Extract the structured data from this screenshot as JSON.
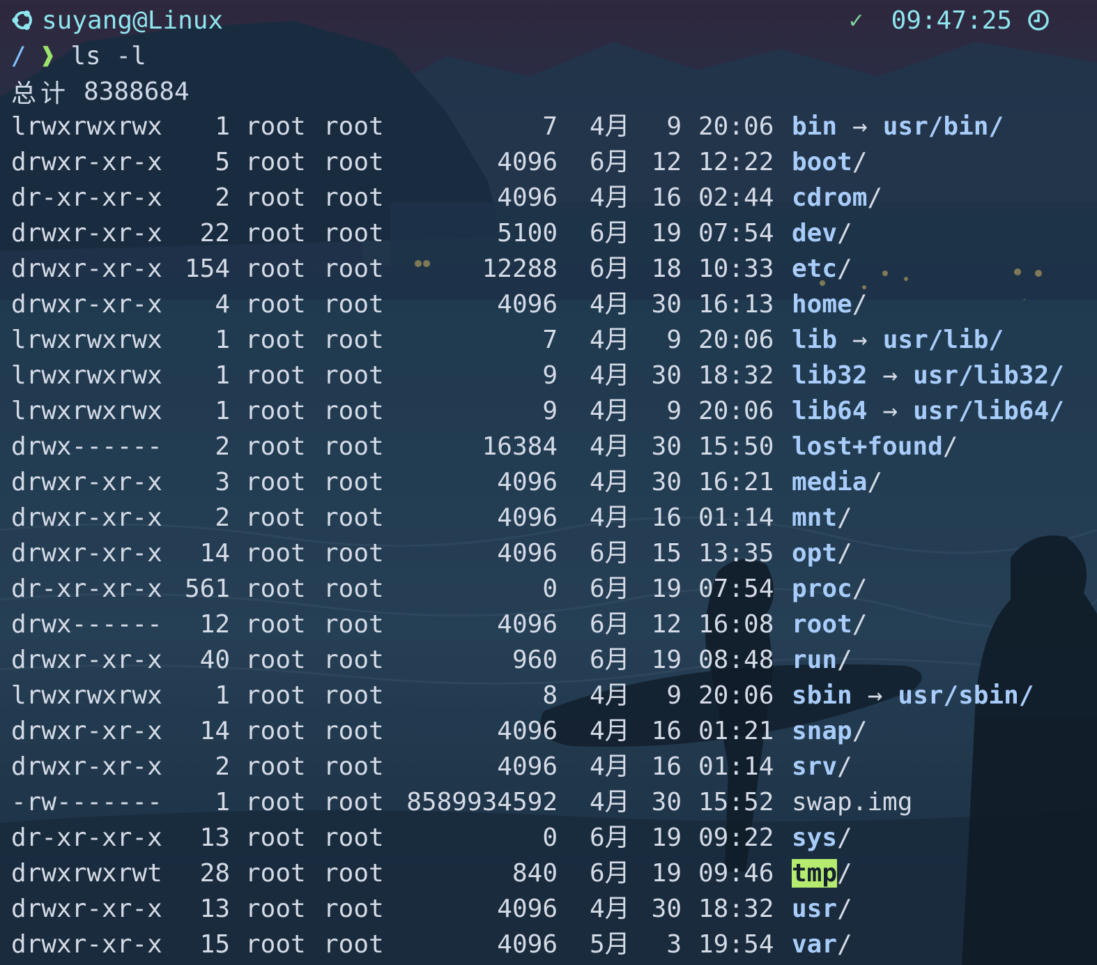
{
  "prompt": {
    "user_host": "suyang@Linux",
    "status_check": "✓",
    "time": "09:47:25",
    "cwd": "/",
    "arrow": "❱",
    "command": "ls -l"
  },
  "total": {
    "label": "总计",
    "value": "8388684"
  },
  "colors": {
    "prompt_cyan": "#8ee6ee",
    "dir_blue": "#a9cdfb",
    "check_green": "#7fd39a",
    "arrow_green": "#9be36b",
    "highlight_bg": "#b5ec6f",
    "text": "#d5dbe6"
  },
  "listing": [
    {
      "perm": "lrwxrwxrwx",
      "links": "1",
      "owner": "root",
      "group": "root",
      "size": "7",
      "month": "4月",
      "day": "9",
      "time": "20:06",
      "name": "bin",
      "suffix": "",
      "target": "usr/bin/",
      "type": "link"
    },
    {
      "perm": "drwxr-xr-x",
      "links": "5",
      "owner": "root",
      "group": "root",
      "size": "4096",
      "month": "6月",
      "day": "12",
      "time": "12:22",
      "name": "boot",
      "suffix": "/",
      "target": "",
      "type": "dir"
    },
    {
      "perm": "dr-xr-xr-x",
      "links": "2",
      "owner": "root",
      "group": "root",
      "size": "4096",
      "month": "4月",
      "day": "16",
      "time": "02:44",
      "name": "cdrom",
      "suffix": "/",
      "target": "",
      "type": "dir"
    },
    {
      "perm": "drwxr-xr-x",
      "links": "22",
      "owner": "root",
      "group": "root",
      "size": "5100",
      "month": "6月",
      "day": "19",
      "time": "07:54",
      "name": "dev",
      "suffix": "/",
      "target": "",
      "type": "dir"
    },
    {
      "perm": "drwxr-xr-x",
      "links": "154",
      "owner": "root",
      "group": "root",
      "size": "12288",
      "month": "6月",
      "day": "18",
      "time": "10:33",
      "name": "etc",
      "suffix": "/",
      "target": "",
      "type": "dir"
    },
    {
      "perm": "drwxr-xr-x",
      "links": "4",
      "owner": "root",
      "group": "root",
      "size": "4096",
      "month": "4月",
      "day": "30",
      "time": "16:13",
      "name": "home",
      "suffix": "/",
      "target": "",
      "type": "dir"
    },
    {
      "perm": "lrwxrwxrwx",
      "links": "1",
      "owner": "root",
      "group": "root",
      "size": "7",
      "month": "4月",
      "day": "9",
      "time": "20:06",
      "name": "lib",
      "suffix": "",
      "target": "usr/lib/",
      "type": "link"
    },
    {
      "perm": "lrwxrwxrwx",
      "links": "1",
      "owner": "root",
      "group": "root",
      "size": "9",
      "month": "4月",
      "day": "30",
      "time": "18:32",
      "name": "lib32",
      "suffix": "",
      "target": "usr/lib32/",
      "type": "link"
    },
    {
      "perm": "lrwxrwxrwx",
      "links": "1",
      "owner": "root",
      "group": "root",
      "size": "9",
      "month": "4月",
      "day": "9",
      "time": "20:06",
      "name": "lib64",
      "suffix": "",
      "target": "usr/lib64/",
      "type": "link"
    },
    {
      "perm": "drwx------",
      "links": "2",
      "owner": "root",
      "group": "root",
      "size": "16384",
      "month": "4月",
      "day": "30",
      "time": "15:50",
      "name": "lost+found",
      "suffix": "/",
      "target": "",
      "type": "dir"
    },
    {
      "perm": "drwxr-xr-x",
      "links": "3",
      "owner": "root",
      "group": "root",
      "size": "4096",
      "month": "4月",
      "day": "30",
      "time": "16:21",
      "name": "media",
      "suffix": "/",
      "target": "",
      "type": "dir"
    },
    {
      "perm": "drwxr-xr-x",
      "links": "2",
      "owner": "root",
      "group": "root",
      "size": "4096",
      "month": "4月",
      "day": "16",
      "time": "01:14",
      "name": "mnt",
      "suffix": "/",
      "target": "",
      "type": "dir"
    },
    {
      "perm": "drwxr-xr-x",
      "links": "14",
      "owner": "root",
      "group": "root",
      "size": "4096",
      "month": "6月",
      "day": "15",
      "time": "13:35",
      "name": "opt",
      "suffix": "/",
      "target": "",
      "type": "dir"
    },
    {
      "perm": "dr-xr-xr-x",
      "links": "561",
      "owner": "root",
      "group": "root",
      "size": "0",
      "month": "6月",
      "day": "19",
      "time": "07:54",
      "name": "proc",
      "suffix": "/",
      "target": "",
      "type": "dir"
    },
    {
      "perm": "drwx------",
      "links": "12",
      "owner": "root",
      "group": "root",
      "size": "4096",
      "month": "6月",
      "day": "12",
      "time": "16:08",
      "name": "root",
      "suffix": "/",
      "target": "",
      "type": "dir"
    },
    {
      "perm": "drwxr-xr-x",
      "links": "40",
      "owner": "root",
      "group": "root",
      "size": "960",
      "month": "6月",
      "day": "19",
      "time": "08:48",
      "name": "run",
      "suffix": "/",
      "target": "",
      "type": "dir"
    },
    {
      "perm": "lrwxrwxrwx",
      "links": "1",
      "owner": "root",
      "group": "root",
      "size": "8",
      "month": "4月",
      "day": "9",
      "time": "20:06",
      "name": "sbin",
      "suffix": "",
      "target": "usr/sbin/",
      "type": "link"
    },
    {
      "perm": "drwxr-xr-x",
      "links": "14",
      "owner": "root",
      "group": "root",
      "size": "4096",
      "month": "4月",
      "day": "16",
      "time": "01:21",
      "name": "snap",
      "suffix": "/",
      "target": "",
      "type": "dir"
    },
    {
      "perm": "drwxr-xr-x",
      "links": "2",
      "owner": "root",
      "group": "root",
      "size": "4096",
      "month": "4月",
      "day": "16",
      "time": "01:14",
      "name": "srv",
      "suffix": "/",
      "target": "",
      "type": "dir"
    },
    {
      "perm": "-rw-------",
      "links": "1",
      "owner": "root",
      "group": "root",
      "size": "8589934592",
      "month": "4月",
      "day": "30",
      "time": "15:52",
      "name": "swap.img",
      "suffix": "",
      "target": "",
      "type": "file"
    },
    {
      "perm": "dr-xr-xr-x",
      "links": "13",
      "owner": "root",
      "group": "root",
      "size": "0",
      "month": "6月",
      "day": "19",
      "time": "09:22",
      "name": "sys",
      "suffix": "/",
      "target": "",
      "type": "dir"
    },
    {
      "perm": "drwxrwxrwt",
      "links": "28",
      "owner": "root",
      "group": "root",
      "size": "840",
      "month": "6月",
      "day": "19",
      "time": "09:46",
      "name": "tmp",
      "suffix": "/",
      "target": "",
      "type": "sticky"
    },
    {
      "perm": "drwxr-xr-x",
      "links": "13",
      "owner": "root",
      "group": "root",
      "size": "4096",
      "month": "4月",
      "day": "30",
      "time": "18:32",
      "name": "usr",
      "suffix": "/",
      "target": "",
      "type": "dir"
    },
    {
      "perm": "drwxr-xr-x",
      "links": "15",
      "owner": "root",
      "group": "root",
      "size": "4096",
      "month": "5月",
      "day": "3",
      "time": "19:54",
      "name": "var",
      "suffix": "/",
      "target": "",
      "type": "dir"
    }
  ],
  "link_arrow": "→"
}
